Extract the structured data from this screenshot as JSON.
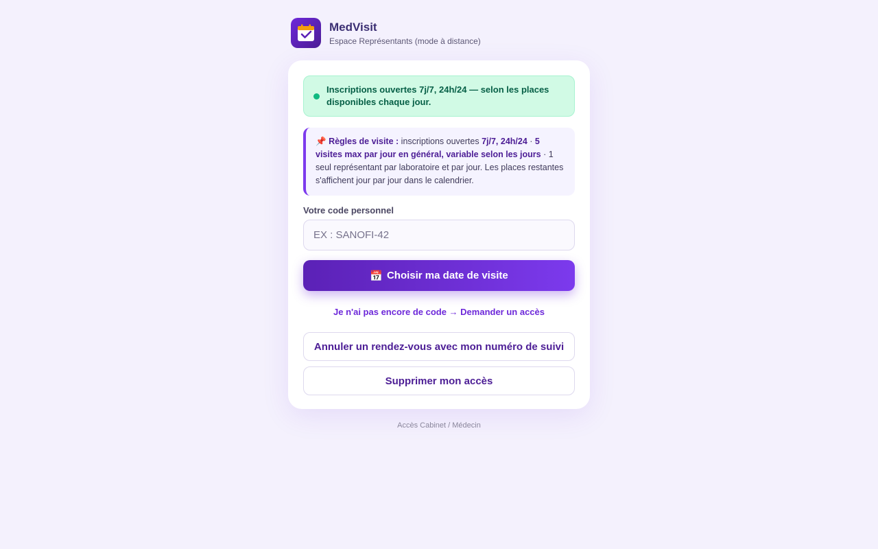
{
  "app": {
    "name": "MedVisit",
    "subtitle": "Espace Représentants (mode à distance)",
    "logo_icon": "calendar-check-icon"
  },
  "status_banner": {
    "text": "Inscriptions ouvertes 7j/7, 24h/24 — selon les places disponibles chaque jour.",
    "color": "#10b981"
  },
  "rules": {
    "icon": "📌",
    "title": "Règles de visite :",
    "part1": " inscriptions ouvertes ",
    "strong1": "7j/7, 24h/24",
    "sep1": " · ",
    "strong2": "5 visites max par jour en général, variable selon les jours",
    "part2": " · 1 seul représentant par laboratoire et par jour. Les places restantes s'affichent jour par jour dans le calendrier."
  },
  "code_field": {
    "label": "Votre code personnel",
    "placeholder": "EX : SANOFI-42",
    "value": ""
  },
  "primary_button": {
    "icon": "📅",
    "label": "Choisir ma date de visite"
  },
  "request_access_link": "Je n'ai pas encore de code → Demander un accès",
  "cancel_button": "Annuler un rendez-vous avec mon numéro de suivi",
  "delete_button": "Supprimer mon accès",
  "footer_link": "Accès Cabinet / Médecin",
  "colors": {
    "accent": "#7c3aed",
    "accent_dark": "#5b21b6",
    "background": "#f4f1fd"
  }
}
